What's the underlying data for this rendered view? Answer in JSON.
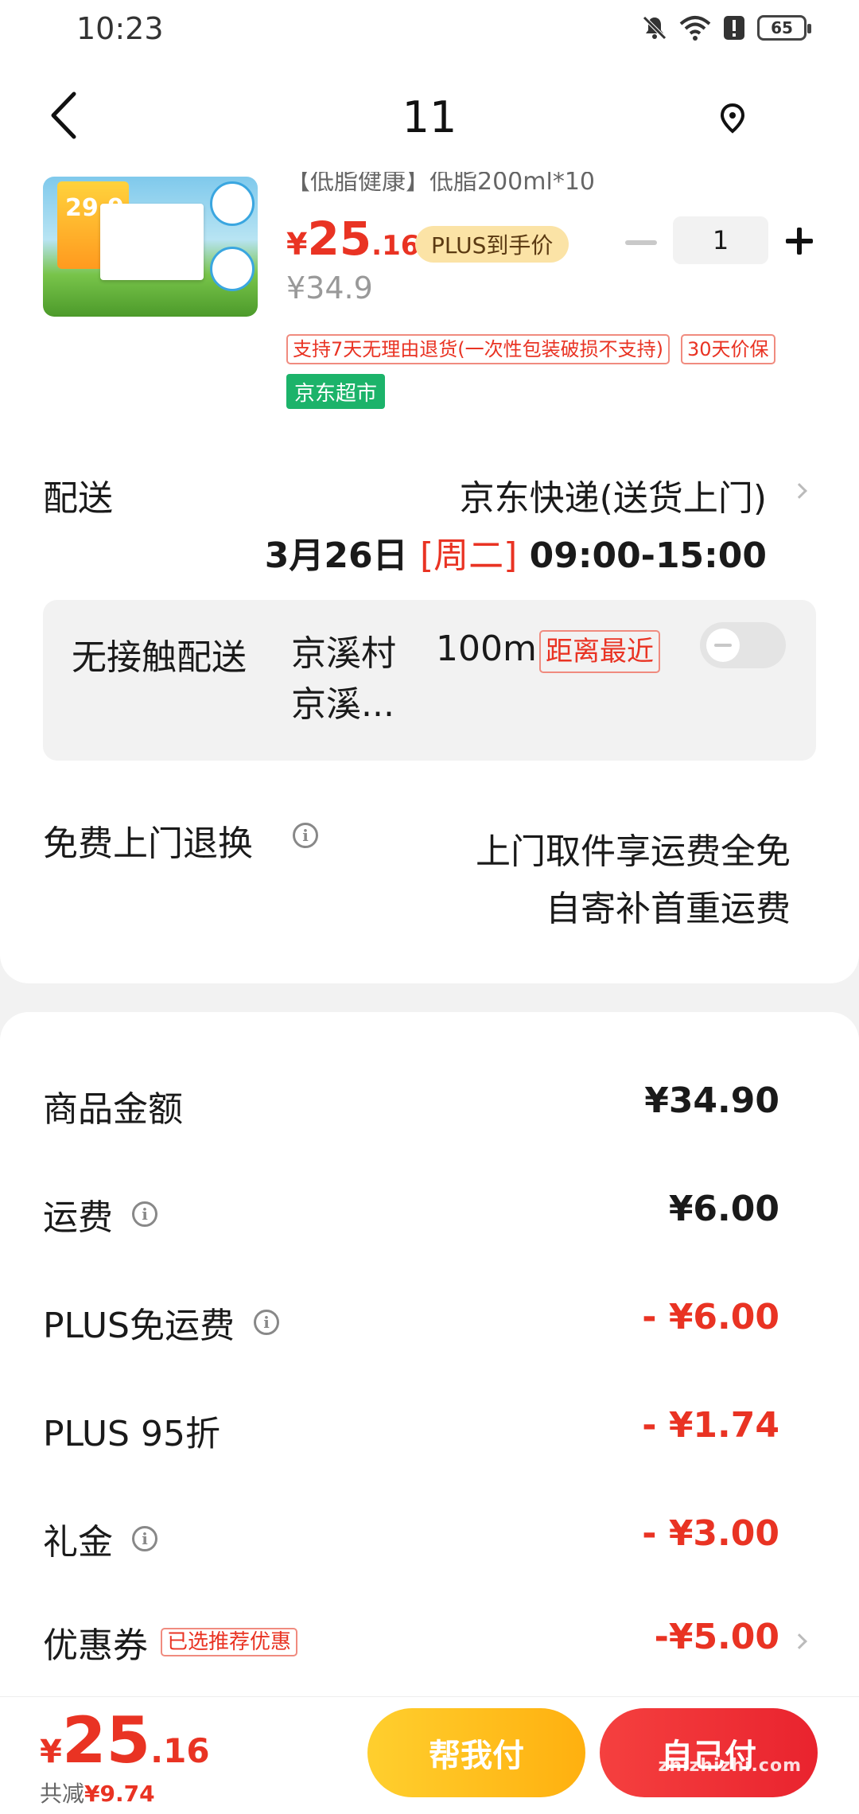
{
  "status_bar": {
    "time": "10:23",
    "battery": "65"
  },
  "nav": {
    "title": "11"
  },
  "product": {
    "name": "【低脂健康】低脂200ml*10",
    "image_price": "29.9",
    "price_symbol": "¥",
    "price_int": "25",
    "price_dec": ".16",
    "plus_badge": "PLUS到手价",
    "quantity": "1",
    "original_price": "¥34.9",
    "service_tags": [
      "支持7天无理由退货(一次性包装破损不支持)",
      "30天价保"
    ],
    "store_tag": "京东超市"
  },
  "delivery": {
    "label": "配送",
    "method": "京东快递(送货上门)",
    "date": "3月26日",
    "weekday": "[周二]",
    "time_range": "09:00-15:00"
  },
  "contactless": {
    "label": "无接触配送",
    "place": "京溪村 京溪...",
    "distance": "100m",
    "nearest_tag": "距离最近"
  },
  "free_return": {
    "label": "免费上门退换",
    "line1": "上门取件享运费全免",
    "line2": "自寄补首重运费"
  },
  "fees": [
    {
      "label": "商品金额",
      "value": "¥34.90",
      "has_info": false,
      "negative": false
    },
    {
      "label": "运费",
      "value": "¥6.00",
      "has_info": true,
      "negative": false
    },
    {
      "label": "PLUS免运费",
      "value": "- ¥6.00",
      "has_info": true,
      "negative": true
    },
    {
      "label": "PLUS 95折",
      "value": "- ¥1.74",
      "has_info": false,
      "negative": true
    },
    {
      "label": "礼金",
      "value": "- ¥3.00",
      "has_info": true,
      "negative": true
    },
    {
      "label": "优惠券",
      "value": "-¥5.00",
      "has_info": false,
      "negative": true,
      "tag": "已选推荐优惠"
    }
  ],
  "bottom": {
    "price_symbol": "¥",
    "price_int": "25",
    "price_dec": ".16",
    "saving_label": "共减",
    "saving_amount": "¥9.74",
    "help_pay": "帮我付",
    "self_pay": "自己付",
    "watermark": "zhizhizhi.com"
  },
  "colors": {
    "accent_red": "#e93323",
    "plus_gold": "#fbe3a6",
    "jd_green": "#1cb36a",
    "help_btn": "#ffbf1f"
  }
}
